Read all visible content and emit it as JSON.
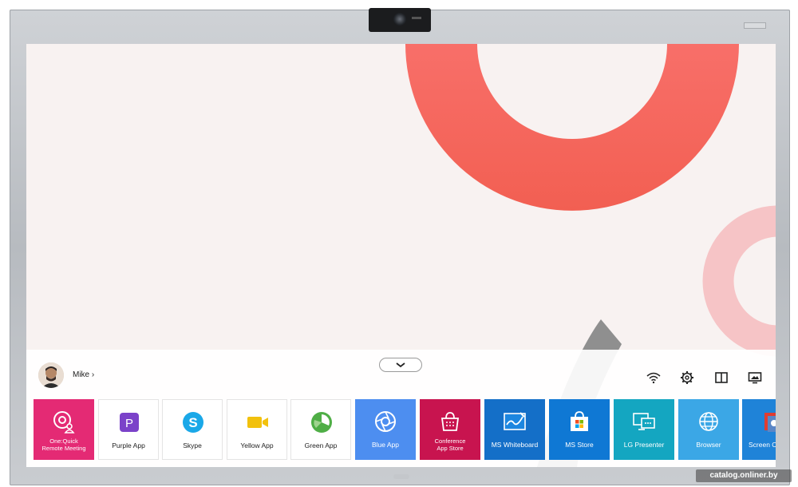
{
  "user": {
    "name": "Mike",
    "chevron": "›"
  },
  "system_icons": [
    "wifi-icon",
    "settings-gear-icon",
    "split-screen-icon",
    "screen-share-icon"
  ],
  "apps": [
    {
      "label_lines": [
        "One:Quick",
        "Remote Meeting"
      ],
      "icon": "one-quick-icon",
      "bg": "#e42a74",
      "text": "#ffffff"
    },
    {
      "label": "Purple App",
      "icon": "purple-app-icon",
      "bg": "#ffffff",
      "accent": "#7b42c9"
    },
    {
      "label": "Skype",
      "icon": "skype-icon",
      "bg": "#ffffff",
      "accent": "#1aa8e8"
    },
    {
      "label": "Yellow App",
      "icon": "yellow-app-icon",
      "bg": "#ffffff",
      "accent": "#f2c10d"
    },
    {
      "label": "Green App",
      "icon": "green-app-icon",
      "bg": "#ffffff",
      "accent": "#4fae46"
    },
    {
      "label": "Blue App",
      "icon": "blue-app-icon",
      "bg": "#4d8ef0",
      "text": "#ffffff"
    },
    {
      "label_lines": [
        "Conference",
        "App Store"
      ],
      "icon": "conference-store-icon",
      "bg": "#c8144f",
      "text": "#ffffff"
    },
    {
      "label": "MS Whiteboard",
      "icon": "whiteboard-icon",
      "bg": "#146fc8",
      "text": "#ffffff"
    },
    {
      "label": "MS Store",
      "icon": "ms-store-icon",
      "bg": "#0f78d4",
      "text": "#ffffff"
    },
    {
      "label": "LG Presenter",
      "icon": "lg-presenter-icon",
      "bg": "#14a6c1",
      "text": "#ffffff"
    },
    {
      "label": "Browser",
      "icon": "browser-icon",
      "bg": "#3ba7e6",
      "text": "#ffffff"
    },
    {
      "label": "Screen C",
      "icon": "screen-c-icon",
      "bg": "#1f83d8",
      "text": "#ffffff"
    }
  ],
  "watermark": "catalog.onliner.by",
  "colors": {
    "accent_red": "#f56a5f",
    "accent_pink": "#f4c3c5",
    "bezel": "#c1c4c8"
  }
}
